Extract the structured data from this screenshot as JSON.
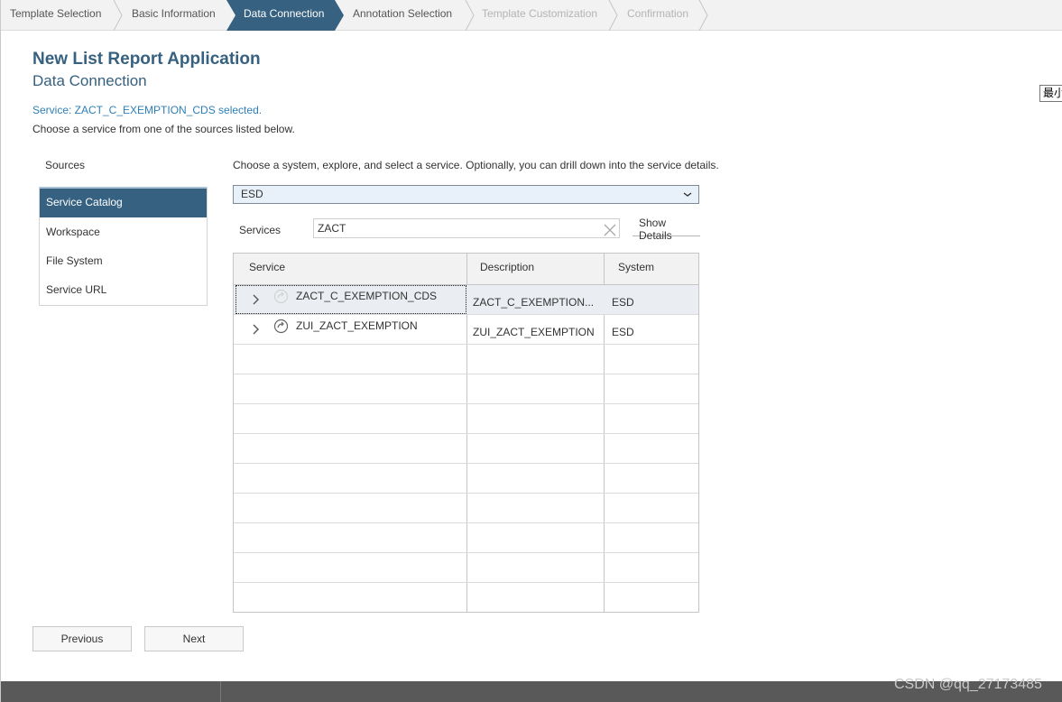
{
  "wizard": {
    "steps": [
      {
        "label": "Template Selection",
        "state": "done"
      },
      {
        "label": "Basic Information",
        "state": "done"
      },
      {
        "label": "Data Connection",
        "state": "active"
      },
      {
        "label": "Annotation Selection",
        "state": "pending"
      },
      {
        "label": "Template Customization",
        "state": "disabled"
      },
      {
        "label": "Confirmation",
        "state": "disabled"
      }
    ]
  },
  "header": {
    "title": "New List Report Application",
    "subtitle": "Data Connection"
  },
  "status": {
    "selected_message": "Service: ZACT_C_EXEMPTION_CDS selected.",
    "instruction": "Choose a service from one of the sources listed below."
  },
  "sources": {
    "label": "Sources",
    "items": [
      {
        "label": "Service Catalog",
        "selected": true
      },
      {
        "label": "Workspace",
        "selected": false
      },
      {
        "label": "File System",
        "selected": false
      },
      {
        "label": "Service URL",
        "selected": false
      }
    ]
  },
  "main": {
    "instruction": "Choose a system, explore, and select a service. Optionally, you can drill down into the service details.",
    "system_value": "ESD",
    "services_label": "Services",
    "search_value": "ZACT",
    "show_details_label": "Show Details"
  },
  "table": {
    "columns": [
      "Service",
      "Description",
      "System"
    ],
    "rows": [
      {
        "service": "ZACT_C_EXEMPTION_CDS",
        "description": "ZACT_C_EXEMPTION...",
        "system": "ESD",
        "selected": true
      },
      {
        "service": "ZUI_ZACT_EXEMPTION",
        "description": "ZUI_ZACT_EXEMPTION",
        "system": "ESD",
        "selected": false
      }
    ]
  },
  "footer": {
    "previous_label": "Previous",
    "next_label": "Next"
  },
  "overlay": {
    "minimize_button": "最小",
    "watermark": "CSDN @qq_27173485"
  },
  "colors": {
    "accent": "#366180",
    "link": "#2d7fb8",
    "step_bar_bg": "#f2f2f2"
  }
}
